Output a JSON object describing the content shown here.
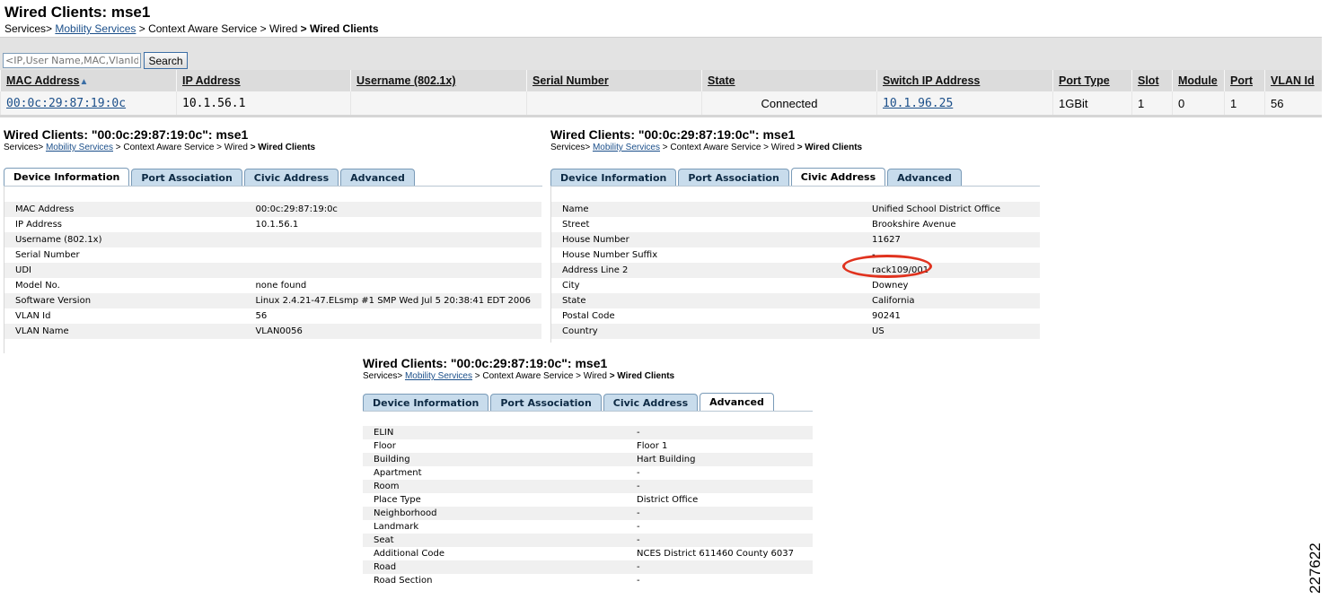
{
  "header": {
    "title": "Wired Clients: mse1",
    "breadcrumb": {
      "services": "Services>",
      "mobility": "Mobility Services",
      "cas": "> Context Aware Service",
      "wired": "> Wired",
      "current": "> Wired Clients"
    }
  },
  "search": {
    "placeholder": "<IP,User Name,MAC,VlanId>",
    "button": "Search"
  },
  "table": {
    "columns": [
      "MAC Address",
      "IP Address",
      "Username (802.1x)",
      "Serial Number",
      "State",
      "Switch IP Address",
      "Port Type",
      "Slot",
      "Module",
      "Port",
      "VLAN Id"
    ],
    "sort_indicator": "▲",
    "rows": [
      {
        "mac": "00:0c:29:87:19:0c",
        "ip": "10.1.56.1",
        "username": "",
        "serial": "",
        "state": "Connected",
        "switch_ip": "10.1.96.25",
        "port_type": "1GBit",
        "slot": "1",
        "module": "0",
        "port": "1",
        "vlan": "56"
      }
    ]
  },
  "detail": {
    "title": "Wired Clients: \"00:0c:29:87:19:0c\": mse1",
    "breadcrumb": {
      "services": "Services>",
      "mobility": "Mobility Services",
      "cas": "> Context Aware Service",
      "wired": "> Wired",
      "current": "> Wired Clients"
    },
    "tabs": [
      "Device Information",
      "Port Association",
      "Civic Address",
      "Advanced"
    ]
  },
  "device_info": {
    "rows": [
      {
        "label": "MAC Address",
        "value": "00:0c:29:87:19:0c"
      },
      {
        "label": "IP Address",
        "value": "10.1.56.1"
      },
      {
        "label": "Username (802.1x)",
        "value": ""
      },
      {
        "label": "Serial Number",
        "value": ""
      },
      {
        "label": "UDI",
        "value": ""
      },
      {
        "label": "Model No.",
        "value": "none found"
      },
      {
        "label": "Software Version",
        "value": "Linux 2.4.21-47.ELsmp #1 SMP Wed Jul 5 20:38:41 EDT 2006"
      },
      {
        "label": "VLAN Id",
        "value": "56"
      },
      {
        "label": "VLAN Name",
        "value": "VLAN0056"
      }
    ]
  },
  "civic_address": {
    "rows": [
      {
        "label": "Name",
        "value": "Unified School District Office"
      },
      {
        "label": "Street",
        "value": "Brookshire Avenue"
      },
      {
        "label": "House Number",
        "value": "11627"
      },
      {
        "label": "House Number Suffix",
        "value": "-"
      },
      {
        "label": "Address Line 2",
        "value": "rack109/001"
      },
      {
        "label": "City",
        "value": "Downey"
      },
      {
        "label": "State",
        "value": "California"
      },
      {
        "label": "Postal Code",
        "value": "90241"
      },
      {
        "label": "Country",
        "value": "US"
      }
    ],
    "highlight_color": "#e0321e"
  },
  "advanced": {
    "rows": [
      {
        "label": "ELIN",
        "value": "-"
      },
      {
        "label": "Floor",
        "value": "Floor 1"
      },
      {
        "label": "Building",
        "value": "Hart Building"
      },
      {
        "label": "Apartment",
        "value": "-"
      },
      {
        "label": "Room",
        "value": "-"
      },
      {
        "label": "Place Type",
        "value": "District Office"
      },
      {
        "label": "Neighborhood",
        "value": "-"
      },
      {
        "label": "Landmark",
        "value": "-"
      },
      {
        "label": "Seat",
        "value": "-"
      },
      {
        "label": "Additional Code",
        "value": "NCES District 611460 County 6037"
      },
      {
        "label": "Road",
        "value": "-"
      },
      {
        "label": "Road Section",
        "value": "-"
      }
    ]
  },
  "figure_id": "227622"
}
